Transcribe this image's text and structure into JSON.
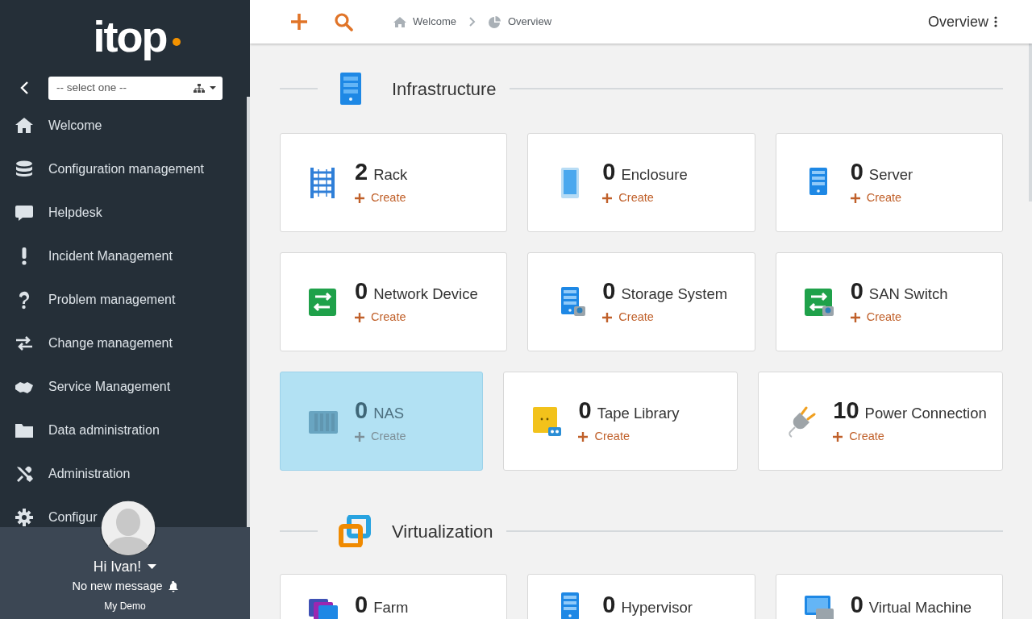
{
  "logo": {
    "text": "itop"
  },
  "sidebar": {
    "select": {
      "placeholder": "-- select one --"
    },
    "items": [
      {
        "label": "Welcome"
      },
      {
        "label": "Configuration management"
      },
      {
        "label": "Helpdesk"
      },
      {
        "label": "Incident Management"
      },
      {
        "label": "Problem management"
      },
      {
        "label": "Change management"
      },
      {
        "label": "Service Management"
      },
      {
        "label": "Data administration"
      },
      {
        "label": "Administration"
      },
      {
        "label": "Configur"
      }
    ]
  },
  "user": {
    "greeting": "Hi Ivan!",
    "messages": "No new message",
    "organization": "My Demo"
  },
  "topbar": {
    "breadcrumbs": [
      {
        "label": "Welcome"
      },
      {
        "label": "Overview"
      }
    ],
    "title": "Overview"
  },
  "sections": [
    {
      "title": "Infrastructure",
      "rows": [
        [
          {
            "count": "2",
            "label": "Rack",
            "action": "Create",
            "selected": false
          },
          {
            "count": "0",
            "label": "Enclosure",
            "action": "Create",
            "selected": false
          },
          {
            "count": "0",
            "label": "Server",
            "action": "Create",
            "selected": false
          }
        ],
        [
          {
            "count": "0",
            "label": "Network Device",
            "action": "Create",
            "selected": false
          },
          {
            "count": "0",
            "label": "Storage System",
            "action": "Create",
            "selected": false
          },
          {
            "count": "0",
            "label": "SAN Switch",
            "action": "Create",
            "selected": false
          }
        ],
        [
          {
            "count": "0",
            "label": "NAS",
            "action": "Create",
            "selected": true
          },
          {
            "count": "0",
            "label": "Tape Library",
            "action": "Create",
            "selected": false
          },
          {
            "count": "10",
            "label": "Power Connection",
            "action": "Create",
            "selected": false
          }
        ]
      ]
    },
    {
      "title": "Virtualization",
      "rows": [
        [
          {
            "count": "0",
            "label": "Farm",
            "selected": false
          },
          {
            "count": "0",
            "label": "Hypervisor",
            "selected": false
          },
          {
            "count": "0",
            "label": "Virtual Machine",
            "selected": false
          }
        ]
      ]
    }
  ]
}
